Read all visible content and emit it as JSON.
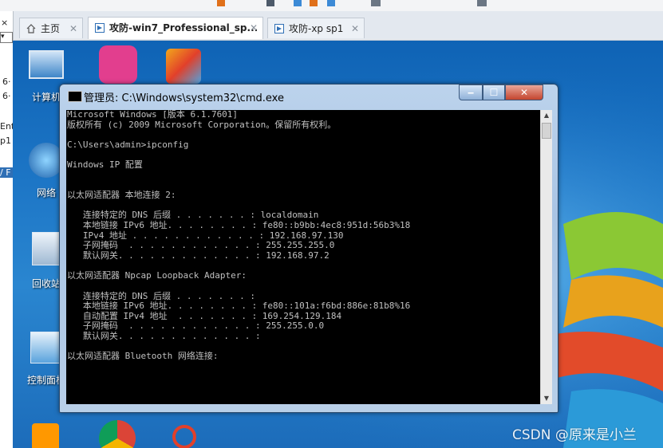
{
  "tabs": [
    {
      "label": "主页",
      "icon": "home-icon",
      "active": false
    },
    {
      "label": "攻防-win7_Professional_sp...",
      "icon": "vm-console-icon",
      "active": true
    },
    {
      "label": "攻防-xp sp1",
      "icon": "vm-console-icon",
      "active": false
    }
  ],
  "sidebar_fragments": [
    "×",
    "▾",
    "6·",
    "6·",
    "Ent",
    "p1",
    "/ F"
  ],
  "desktop_icons": [
    {
      "label": "计算机",
      "icon": "computer-icon"
    },
    {
      "label": "网络",
      "icon": "network-icon"
    },
    {
      "label": "回收站",
      "icon": "recycle-bin-icon"
    },
    {
      "label": "控制面板",
      "icon": "control-panel-icon"
    }
  ],
  "cmd": {
    "title": "管理员: C:\\Windows\\system32\\cmd.exe",
    "lines": [
      "Microsoft Windows [版本 6.1.7601]",
      "版权所有 (c) 2009 Microsoft Corporation。保留所有权利。",
      "",
      "C:\\Users\\admin>ipconfig",
      "",
      "Windows IP 配置",
      "",
      "",
      "以太网适配器 本地连接 2:",
      "",
      "   连接特定的 DNS 后缀 . . . . . . . : localdomain",
      "   本地链接 IPv6 地址. . . . . . . . : fe80::b9bb:4ec8:951d:56b3%18",
      "   IPv4 地址 . . . . . . . . . . . . : 192.168.97.130",
      "   子网掩码  . . . . . . . . . . . . : 255.255.255.0",
      "   默认网关. . . . . . . . . . . . . : 192.168.97.2",
      "",
      "以太网适配器 Npcap Loopback Adapter:",
      "",
      "   连接特定的 DNS 后缀 . . . . . . . :",
      "   本地链接 IPv6 地址. . . . . . . . : fe80::101a:f6bd:886e:81b8%16",
      "   自动配置 IPv4 地址  . . . . . . . : 169.254.129.184",
      "   子网掩码  . . . . . . . . . . . . : 255.255.0.0",
      "   默认网关. . . . . . . . . . . . . :",
      "",
      "以太网适配器 Bluetooth 网络连接:"
    ]
  },
  "watermark": "CSDN @原来是小兰",
  "colors": {
    "desktop": "#1d76c6",
    "console_bg": "#000000",
    "console_fg": "#c0c0c0",
    "close_btn": "#c4452e"
  }
}
